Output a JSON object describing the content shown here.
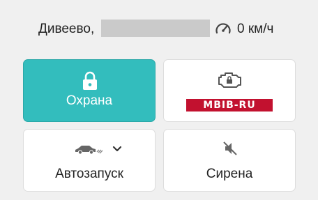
{
  "header": {
    "location": "Дивеево,",
    "speed": "0 км/ч",
    "speed_icon": "speedometer-icon"
  },
  "tiles": {
    "guard": {
      "label": "Охрана",
      "icon": "lock-icon",
      "active": true
    },
    "diagnostics": {
      "icon": "engine-check-icon",
      "badge": "MBIB-RU"
    },
    "autostart": {
      "label": "Автозапуск",
      "icon": "car-icon",
      "dropdown_icon": "chevron-down-icon"
    },
    "siren": {
      "label": "Сирена",
      "icon": "mute-icon"
    }
  },
  "colors": {
    "active_tile": "#33bdbd",
    "badge_red": "#c2112f",
    "background": "#f0f0f0",
    "masked_field": "#cacaca"
  }
}
